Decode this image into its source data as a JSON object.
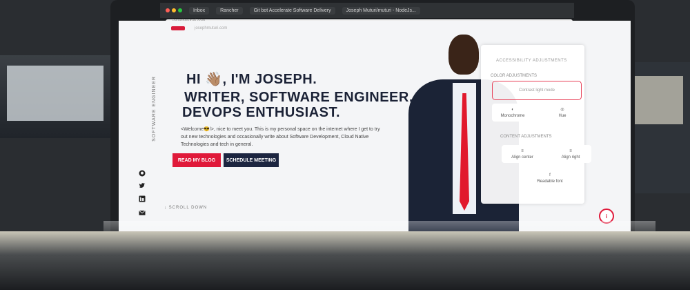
{
  "browser": {
    "tabs": [
      "Inbox",
      "Rancher",
      "Git bot Accelerate Software Delivery",
      "Joseph Muturi/muturi - NodeJs..."
    ],
    "url": "josephmuturi.com"
  },
  "site": {
    "side_tag": "SOFTWARE ENGINEER",
    "hero": {
      "line1": "HI 👋🏽, I'M JOSEPH.",
      "line2": "WRITER, SOFTWARE ENGINEER,",
      "line3": "DEVOPS ENTHUSIAST."
    },
    "intro": "<Welcome😎/>, nice to meet you. This is my personal space on the internet where I get to try out new technologies and occasionally write about Software Development, Cloud Native Technologies and tech in general.",
    "buttons": {
      "blog": "READ MY BLOG",
      "meeting": "SCHEDULE MEETING"
    },
    "scroll_down": "SCROLL DOWN",
    "social_icons": [
      "github-icon",
      "twitter-icon",
      "linkedin-icon",
      "mail-icon"
    ]
  },
  "a11y": {
    "title": "ACCESSIBILITY ADJUSTMENTS",
    "color_section": "COLOR ADJUSTMENTS",
    "contrast_label": "Contrast light mode",
    "monochrome_label": "Monochrome",
    "hue_label": "Hue",
    "content_section": "CONTENT ADJUSTMENTS",
    "align_center_label": "Align center",
    "align_right_label": "Align right",
    "reading_label": "Readable font"
  },
  "colors": {
    "accent": "#e0193a",
    "navy": "#1c2540",
    "hero_text": "#1b2236"
  }
}
